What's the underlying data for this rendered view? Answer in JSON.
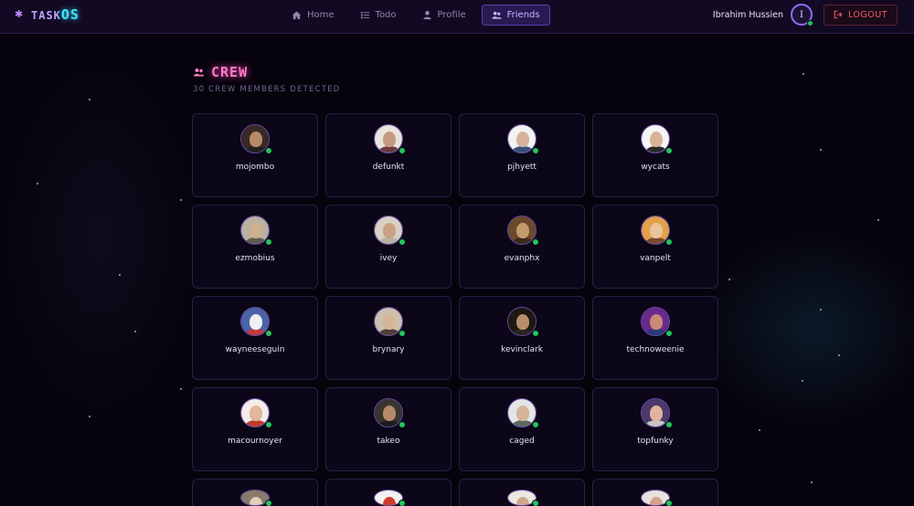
{
  "app": {
    "brand_prefix": "TASK",
    "brand_suffix": "OS"
  },
  "nav": [
    {
      "label": "Home",
      "icon": "home-icon",
      "active": false
    },
    {
      "label": "Todo",
      "icon": "list-icon",
      "active": false
    },
    {
      "label": "Profile",
      "icon": "user-icon",
      "active": false
    },
    {
      "label": "Friends",
      "icon": "users-icon",
      "active": true
    }
  ],
  "user": {
    "name": "Ibrahim Hussien",
    "initial": "I",
    "logout_label": "LOGOUT"
  },
  "page": {
    "title": "CREW",
    "subtitle": "30 CREW MEMBERS DETECTED"
  },
  "friends": [
    {
      "username": "mojombo",
      "bg": "#3a2a26",
      "skin": "#b88a6a",
      "shirt": "#222222"
    },
    {
      "username": "defunkt",
      "bg": "#e9e4de",
      "skin": "#c49a84",
      "shirt": "#6b3b3b"
    },
    {
      "username": "pjhyett",
      "bg": "#f2f2f2",
      "skin": "#d6b39a",
      "shirt": "#37507a"
    },
    {
      "username": "wycats",
      "bg": "#f5f5f5",
      "skin": "#d9b396",
      "shirt": "#2a2a2a"
    },
    {
      "username": "ezmobius",
      "bg": "#b9b2a3",
      "skin": "#cfb08f",
      "shirt": "#5e5a52"
    },
    {
      "username": "ivey",
      "bg": "#d8d0c4",
      "skin": "#c9a184",
      "shirt": "#b9b0a0"
    },
    {
      "username": "evanphx",
      "bg": "#6a4a2a",
      "skin": "#c39b6c",
      "shirt": "#3b2a1a"
    },
    {
      "username": "vanpelt",
      "bg": "#e1a24a",
      "skin": "#e9c39a",
      "shirt": "#7a4a2a"
    },
    {
      "username": "wayneeseguin",
      "bg": "#4a64a8",
      "skin": "#f0f0f0",
      "shirt": "#c23a3a"
    },
    {
      "username": "brynary",
      "bg": "#cdbfae",
      "skin": "#d7b598",
      "shirt": "#4c4036"
    },
    {
      "username": "kevinclark",
      "bg": "#1e1812",
      "skin": "#b88d6a",
      "shirt": "#2a2420"
    },
    {
      "username": "technoweenie",
      "bg": "#6a2a8a",
      "skin": "#c98a7a",
      "shirt": "#2a3a7a"
    },
    {
      "username": "macournoyer",
      "bg": "#f2ede8",
      "skin": "#e3b59a",
      "shirt": "#c0392b"
    },
    {
      "username": "takeo",
      "bg": "#3a3430",
      "skin": "#b5896a",
      "shirt": "#1c1c1c"
    },
    {
      "username": "caged",
      "bg": "#e3e6e4",
      "skin": "#d4b398",
      "shirt": "#5a6a5a"
    },
    {
      "username": "topfunky",
      "bg": "#4a3a6a",
      "skin": "#e0b49c",
      "shirt": "#c7c7c7"
    },
    {
      "username": "",
      "bg": "#8a7a6a",
      "skin": "#e0d0b8",
      "shirt": "#5a4a3a"
    },
    {
      "username": "",
      "bg": "#f2f2f2",
      "skin": "#d03a2a",
      "shirt": "#c02a20"
    },
    {
      "username": "",
      "bg": "#ebe7e2",
      "skin": "#d0a888",
      "shirt": "#6a5a4a"
    },
    {
      "username": "",
      "bg": "#e8e2dc",
      "skin": "#d2a48a",
      "shirt": "#3a2a2a"
    }
  ]
}
